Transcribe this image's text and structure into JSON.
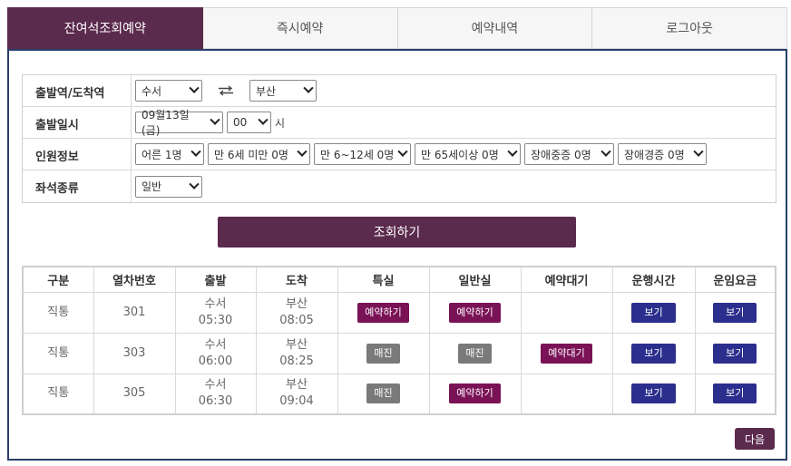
{
  "tabs": [
    {
      "label": "잔여석조회예약",
      "active": true
    },
    {
      "label": "즉시예약",
      "active": false
    },
    {
      "label": "예약내역",
      "active": false
    },
    {
      "label": "로그아웃",
      "active": false
    }
  ],
  "form": {
    "station_label": "출발역/도착역",
    "departure_station": "수서",
    "arrival_station": "부산",
    "datetime_label": "출발일시",
    "date": "09월13일(금)",
    "hour": "00",
    "hour_unit": "시",
    "passenger_label": "인원정보",
    "passengers": [
      "어른 1명",
      "만 6세 미만 0명",
      "만 6~12세 0명",
      "만 65세이상 0명",
      "장애중증 0명",
      "장애경증 0명"
    ],
    "seat_label": "좌석종류",
    "seat_type": "일반"
  },
  "search_label": "조회하기",
  "table": {
    "headers": [
      "구분",
      "열차번호",
      "출발",
      "도착",
      "특실",
      "일반실",
      "예약대기",
      "운행시간",
      "운임요금"
    ],
    "rows": [
      {
        "type": "직통",
        "train_no": "301",
        "dep_station": "수서",
        "dep_time": "05:30",
        "arr_station": "부산",
        "arr_time": "08:05",
        "first": "예약하기",
        "general": "예약하기",
        "waitlist": "",
        "runtime": "보기",
        "fare": "보기"
      },
      {
        "type": "직통",
        "train_no": "303",
        "dep_station": "수서",
        "dep_time": "06:00",
        "arr_station": "부산",
        "arr_time": "08:25",
        "first": "매진",
        "general": "매진",
        "waitlist": "예약대기",
        "runtime": "보기",
        "fare": "보기"
      },
      {
        "type": "직통",
        "train_no": "305",
        "dep_station": "수서",
        "dep_time": "06:30",
        "arr_station": "부산",
        "arr_time": "09:04",
        "first": "매진",
        "general": "예약하기",
        "waitlist": "",
        "runtime": "보기",
        "fare": "보기"
      }
    ]
  },
  "next_label": "다음",
  "colors": {
    "primary": "#5b2b4e",
    "reserve": "#7a1256",
    "soldout": "#7a7a7a",
    "view": "#2b2e8c",
    "border": "#2a3f6b"
  }
}
